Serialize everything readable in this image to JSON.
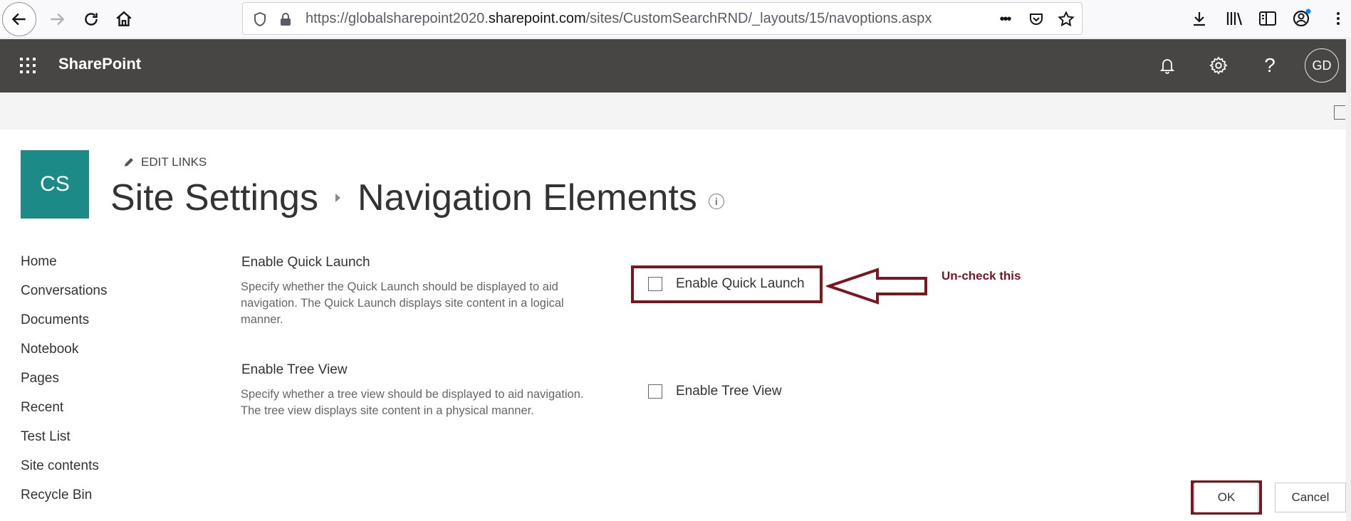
{
  "browser": {
    "url_prefix": "https://globalsharepoint2020.",
    "url_host": "sharepoint.com",
    "url_path": "/sites/CustomSearchRND/_layouts/15/navoptions.aspx",
    "more_dots": "•••"
  },
  "suite_bar": {
    "brand": "SharePoint",
    "avatar_initials": "GD",
    "help_glyph": "?"
  },
  "site": {
    "logo_initials": "CS",
    "edit_links_label": "EDIT LINKS",
    "breadcrumb_parent": "Site Settings",
    "page_title": "Navigation Elements",
    "info_glyph": "i"
  },
  "quick_launch": {
    "items": [
      "Home",
      "Conversations",
      "Documents",
      "Notebook",
      "Pages",
      "Recent",
      "Test List",
      "Site contents",
      "Recycle Bin"
    ]
  },
  "sections": {
    "quick_launch": {
      "title": "Enable Quick Launch",
      "description": "Specify whether the Quick Launch should be displayed to aid navigation.  The Quick Launch displays site content in a logical manner.",
      "checkbox_label": "Enable Quick Launch",
      "checked": false
    },
    "tree_view": {
      "title": "Enable Tree View",
      "description": "Specify whether a tree view should be displayed to aid navigation.  The tree view displays site content in a physical manner.",
      "checkbox_label": "Enable Tree View",
      "checked": false
    }
  },
  "annotation": {
    "text": "Un-check this",
    "color": "#7b1520"
  },
  "buttons": {
    "ok": "OK",
    "cancel": "Cancel"
  },
  "colors": {
    "suite_bar": "#484644",
    "site_logo": "#1c8b88",
    "annotation": "#7b1520"
  }
}
